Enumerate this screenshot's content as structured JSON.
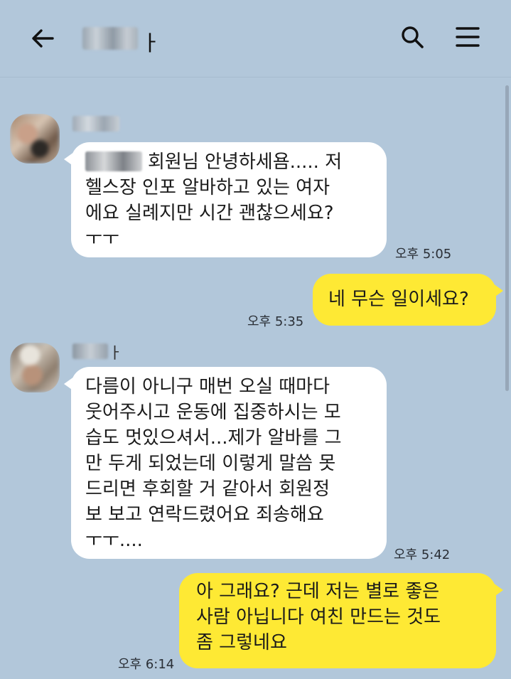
{
  "header": {
    "title_visible_suffix": "ㅏ",
    "back_icon": "arrow-left-icon",
    "search_icon": "search-icon",
    "menu_icon": "hamburger-menu-icon",
    "background_color": "#b2c7da"
  },
  "colors": {
    "chat_background": "#b2c7da",
    "received_bubble": "#ffffff",
    "sent_bubble": "#fee934",
    "text": "#1a1a1a"
  },
  "messages": [
    {
      "direction": "received",
      "sender_name_visible": "",
      "lines": [
        "회원님 안녕하세욤..... 저",
        "헬스장 인포 알바하고 있는 여자",
        "에요 실례지만 시간 괜찮으세요?",
        "ㅜㅜ"
      ],
      "time": "오후 5:05"
    },
    {
      "direction": "sent",
      "lines": [
        "네 무슨 일이세요?"
      ],
      "time": "오후 5:35"
    },
    {
      "direction": "received",
      "sender_name_visible": "ㅏ",
      "lines": [
        "다름이 아니구 매번 오실 때마다",
        "웃어주시고 운동에 집중하시는 모",
        "습도 멋있으셔서...제가 알바를 그",
        "만 두게 되었는데 이렇게 말씀 못",
        "드리면 후회할 거 같아서 회원정",
        "보 보고 연락드렸어요 죄송해요",
        "ㅜㅜ...."
      ],
      "time": "오후 5:42"
    },
    {
      "direction": "sent",
      "lines": [
        "아 그래요? 근데 저는 별로 좋은",
        "사람 아닙니다 여친 만드는 것도",
        "좀 그렇네요"
      ],
      "time": "오후 6:14"
    }
  ]
}
